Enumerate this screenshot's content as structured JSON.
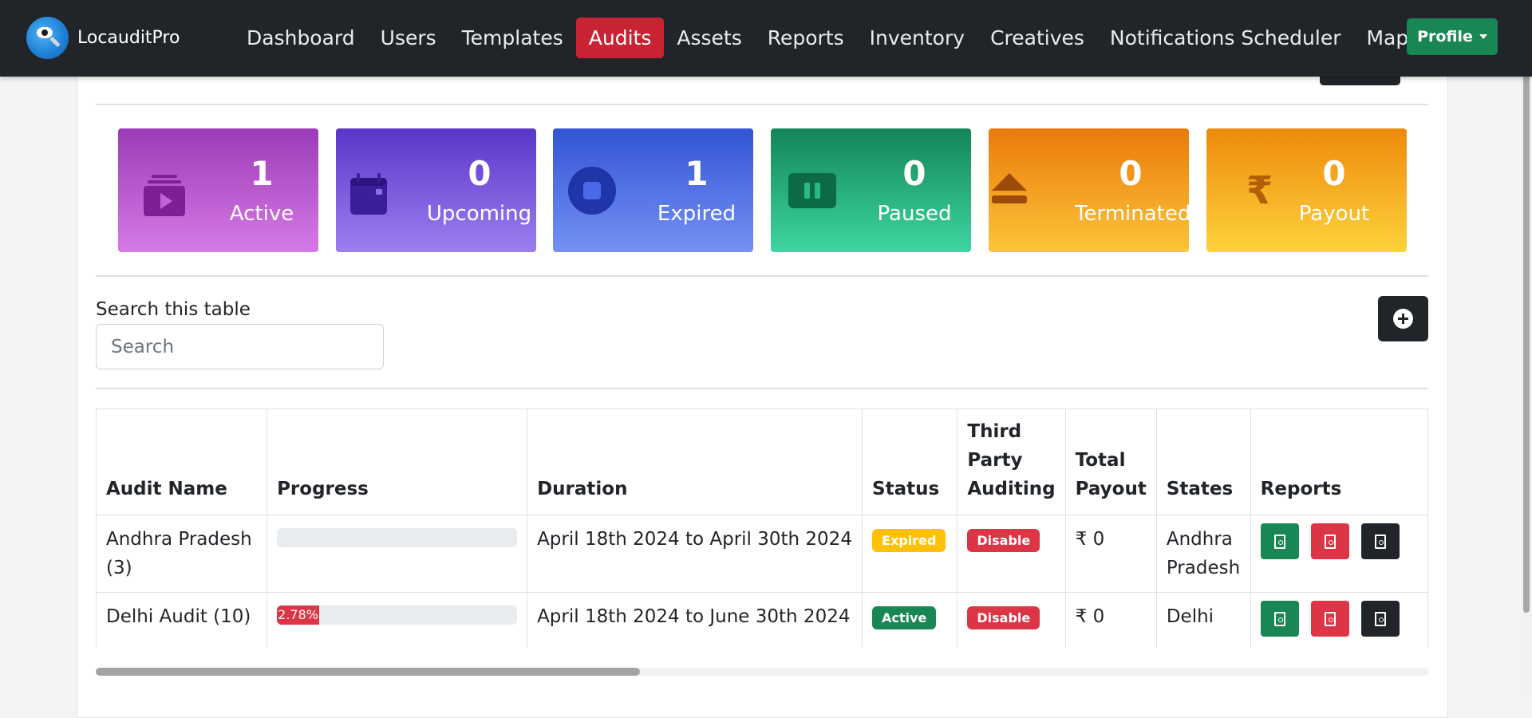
{
  "app": {
    "brand_name": "LocauditPro"
  },
  "nav": {
    "items": [
      {
        "label": "Dashboard"
      },
      {
        "label": "Users"
      },
      {
        "label": "Templates"
      },
      {
        "label": "Audits",
        "active": true
      },
      {
        "label": "Assets"
      },
      {
        "label": "Reports"
      },
      {
        "label": "Inventory"
      },
      {
        "label": "Creatives"
      },
      {
        "label": "Notifications Scheduler"
      },
      {
        "label": "Map"
      }
    ],
    "profile_label": "Profile"
  },
  "stats": {
    "active": {
      "count": "1",
      "label": "Active",
      "icon": "play-stack-icon"
    },
    "upcoming": {
      "count": "0",
      "label": "Upcoming",
      "icon": "calendar-icon"
    },
    "expired": {
      "count": "1",
      "label": "Expired",
      "icon": "stop-circle-icon"
    },
    "paused": {
      "count": "0",
      "label": "Paused",
      "icon": "pause-icon"
    },
    "terminated": {
      "count": "0",
      "label": "Terminated",
      "icon": "eject-icon"
    },
    "payout": {
      "count": "0",
      "label": "Payout",
      "icon": "rupee-icon"
    }
  },
  "search": {
    "label": "Search this table",
    "placeholder": "Search",
    "value": ""
  },
  "table": {
    "columns": {
      "audit_name": "Audit Name",
      "progress": "Progress",
      "duration": "Duration",
      "status": "Status",
      "third_party": "Third Party Auditing",
      "total_payout": "Total Payout",
      "states": "States",
      "reports": "Reports"
    },
    "rows": [
      {
        "audit_name": "Andhra Pradesh (3)",
        "progress_label": "",
        "progress_fraction": 0,
        "duration": "April 18th 2024 to April 30th 2024",
        "status": "Expired",
        "third_party": "Disable",
        "total_payout": "₹ 0",
        "states": "Andhra Pradesh"
      },
      {
        "audit_name": "Delhi Audit (10)",
        "progress_label": "2.78%",
        "progress_fraction": 0.0278,
        "duration": "April 18th 2024 to June 30th 2024",
        "status": "Active",
        "third_party": "Disable",
        "total_payout": "₹ 0",
        "states": "Delhi"
      }
    ]
  },
  "colors": {
    "navbar": "#212529",
    "active_nav": "#c82333",
    "profile": "#198754",
    "badge_expired": "#ffc107",
    "badge_active": "#198754",
    "badge_disable": "#dc3545"
  }
}
